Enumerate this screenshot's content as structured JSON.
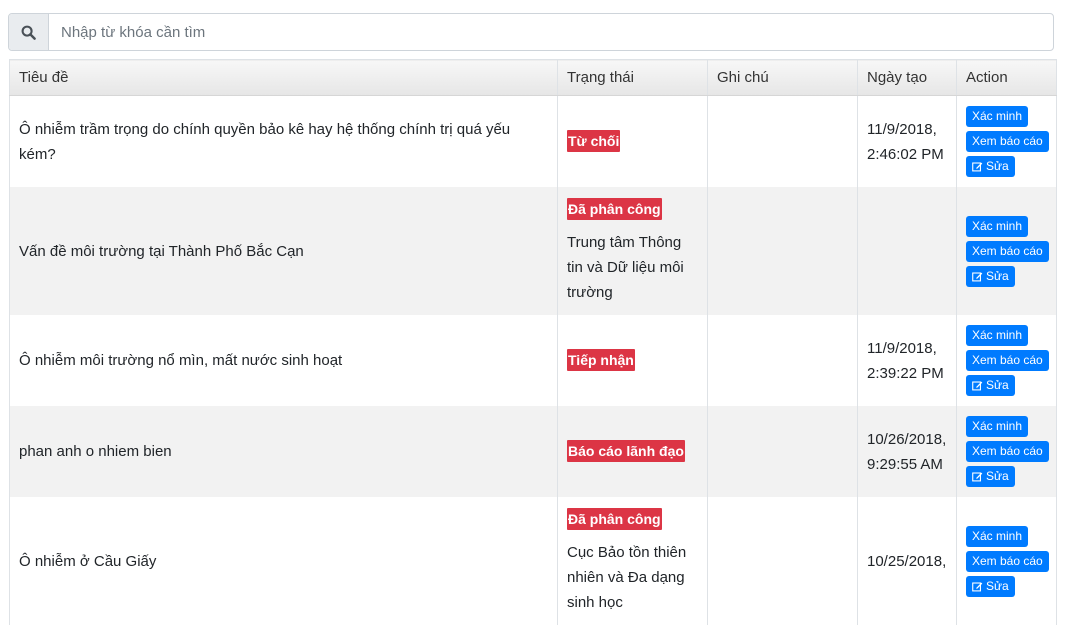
{
  "search": {
    "placeholder": "Nhập từ khóa cần tìm",
    "icon": "search-icon"
  },
  "table": {
    "headers": {
      "title": "Tiêu đề",
      "status": "Trạng thái",
      "note": "Ghi chú",
      "created": "Ngày tạo",
      "action": "Action"
    },
    "action_labels": {
      "verify": "Xác minh",
      "view_report": "Xem báo cáo",
      "edit": "Sửa"
    },
    "status_color": "#dc3545",
    "button_color": "#007bff",
    "rows": [
      {
        "title": "Ô nhiễm trầm trọng do chính quyền bảo kê hay hệ thống chính trị quá yếu kém?",
        "status": "Từ chối",
        "status_note": "",
        "note": "",
        "created_date": "11/9/2018,",
        "created_time": "2:46:02 PM"
      },
      {
        "title": "Vấn đề môi trường tại Thành Phố Bắc Cạn",
        "status": "Đã phân công",
        "status_note": "Trung tâm Thông tin và Dữ liệu môi trường",
        "note": "",
        "created_date": "",
        "created_time": ""
      },
      {
        "title": "Ô nhiễm môi trường nổ mìn, mất nước sinh hoạt",
        "status": "Tiếp nhận",
        "status_note": "",
        "note": "",
        "created_date": "11/9/2018,",
        "created_time": "2:39:22 PM"
      },
      {
        "title": "phan anh o nhiem bien",
        "status": "Báo cáo lãnh đạo",
        "status_note": "",
        "note": "",
        "created_date": "10/26/2018,",
        "created_time": "9:29:55 AM"
      },
      {
        "title": "Ô nhiễm ở Cầu Giấy",
        "status": "Đã phân công",
        "status_note": "Cục Bảo tồn thiên nhiên và Đa dạng sinh học",
        "note": "",
        "created_date": "10/25/2018,",
        "created_time": ""
      }
    ]
  }
}
